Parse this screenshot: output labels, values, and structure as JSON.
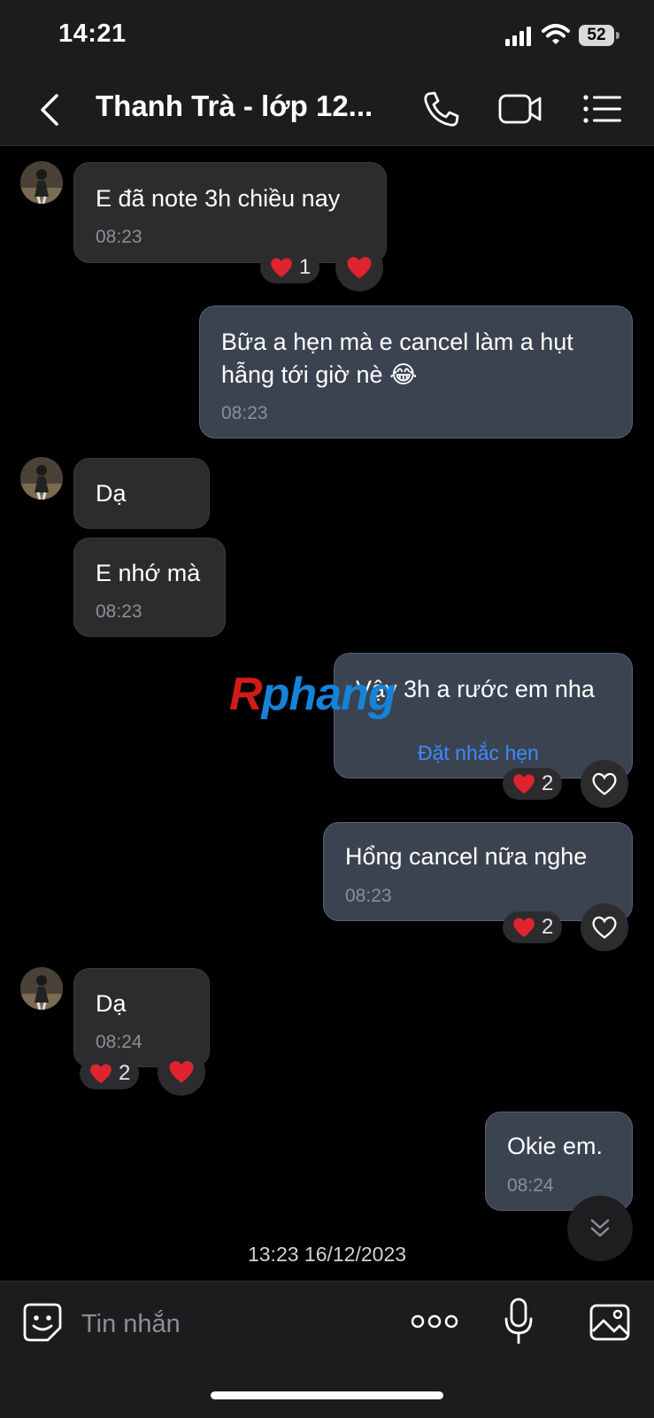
{
  "status_bar": {
    "time": "14:21",
    "battery": "52"
  },
  "header": {
    "title": "Thanh Trà - lớp 12..."
  },
  "messages": [
    {
      "text": "E đã note 3h chiều nay",
      "time": "08:23",
      "reaction_count": "1"
    },
    {
      "line1": "Bữa a hẹn mà e cancel làm a hụt",
      "line2": "hẫng tới giờ nè 😂",
      "time": "08:23"
    },
    {
      "text": "Dạ"
    },
    {
      "text": "E nhớ mà",
      "time": "08:23"
    },
    {
      "text": "Vậy 3h a rước em nha",
      "action": "Đặt nhắc hẹn",
      "reaction_count": "2"
    },
    {
      "text": "Hổng cancel nữa nghe",
      "time": "08:23",
      "reaction_count": "2"
    },
    {
      "text": "Dạ",
      "time": "08:24",
      "reaction_count": "2"
    },
    {
      "text": "Okie em.",
      "time": "08:24"
    }
  ],
  "date_separator": "13:23 16/12/2023",
  "watermark": {
    "first": "R",
    "rest": "phang"
  },
  "composer": {
    "placeholder": "Tin nhắn"
  },
  "colors": {
    "incoming_bubble": "#2c2c2e",
    "outgoing_bubble": "#3b4351",
    "heart": "#e0242f",
    "link": "#3d8bfd"
  }
}
